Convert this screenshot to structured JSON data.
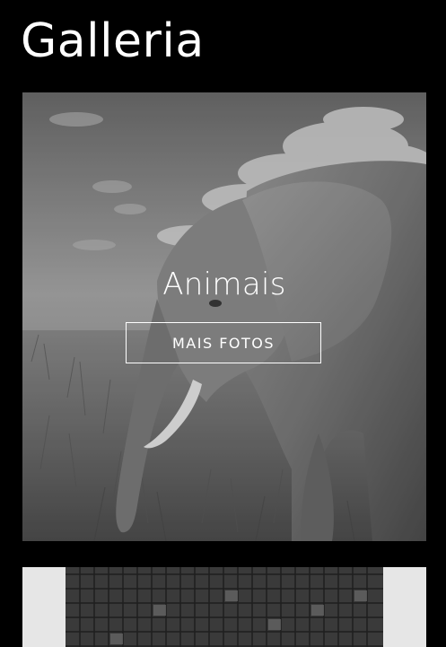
{
  "page": {
    "title": "Galleria"
  },
  "gallery": {
    "cards": [
      {
        "title": "Animais",
        "button_label": "MAIS FOTOS",
        "image": "elephant-in-grassland-photo"
      },
      {
        "image": "building-glass-facade-photo"
      }
    ]
  },
  "colors": {
    "background": "#000000",
    "text": "#ffffff"
  }
}
